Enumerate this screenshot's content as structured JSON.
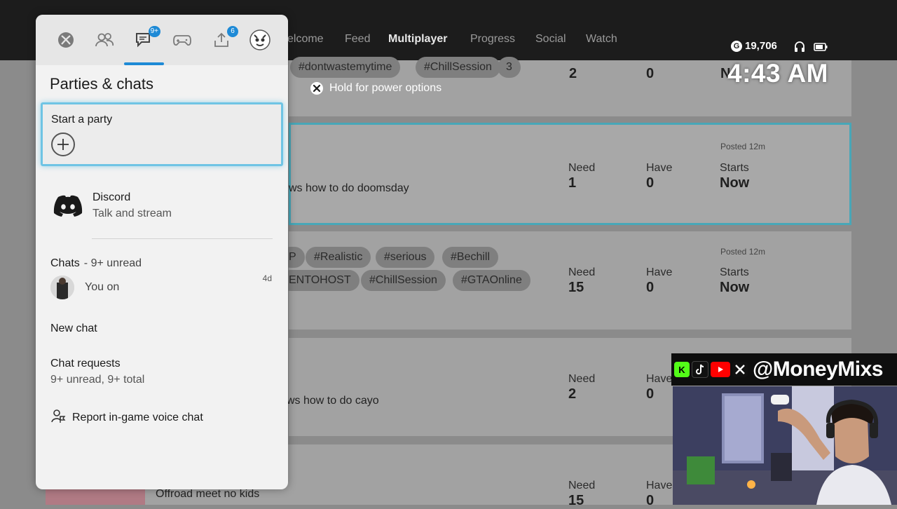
{
  "bg": {
    "nav": [
      "elcome",
      "Feed",
      "Multiplayer",
      "Progress",
      "Social",
      "Watch"
    ],
    "gamerscore": "19,706",
    "gamerscore_glyph": "G",
    "clock": "4:43 AM",
    "power_hint": "Hold for power options",
    "cards": [
      {
        "tags": [
          "#dontwastemytime",
          "#ChillSession",
          "3"
        ],
        "need": "2",
        "have": "0",
        "starts": "N"
      },
      {
        "posted": "Posted 12m",
        "desc": "ws how to do doomsday",
        "need_label": "Need",
        "have_label": "Have",
        "starts_label": "Starts",
        "need": "1",
        "have": "0",
        "starts": "Now"
      },
      {
        "posted": "Posted 12m",
        "tags_row1": [
          "P",
          "#Realistic",
          "#serious",
          "#Bechill"
        ],
        "tags_row2": [
          "ENTOHOST",
          "#ChillSession",
          "#GTAOnline"
        ],
        "need_label": "Need",
        "have_label": "Have",
        "starts_label": "Starts",
        "need": "15",
        "have": "0",
        "starts": "Now"
      },
      {
        "desc": "ws how to do cayo",
        "need_label": "Need",
        "have_label": "Have",
        "need": "2",
        "have": "0"
      },
      {
        "desc": "Offroad meet no kids",
        "need_label": "Need",
        "have_label": "Have",
        "need": "15",
        "have": "0"
      }
    ]
  },
  "guide": {
    "tabs": [
      {
        "icon": "xbox-icon",
        "badge": ""
      },
      {
        "icon": "people-icon",
        "badge": ""
      },
      {
        "icon": "chat-icon",
        "badge": "9+"
      },
      {
        "icon": "controller-icon",
        "badge": ""
      },
      {
        "icon": "upload-icon",
        "badge": "6"
      },
      {
        "icon": "profile-icon",
        "badge": ""
      }
    ],
    "title": "Parties & chats",
    "start_party": "Start a party",
    "discord_name": "Discord",
    "discord_sub": "Talk and stream",
    "chats_label": "Chats",
    "chats_unread": "- 9+ unread",
    "chat_preview": "You on",
    "chat_time": "4d",
    "new_chat": "New chat",
    "chat_requests": "Chat requests",
    "chat_requests_sub": "9+ unread, 9+ total",
    "report": "Report in-game voice chat"
  },
  "overlay": {
    "handle": "@MoneyMixs",
    "socials": [
      "K",
      "tiktok",
      "youtube",
      "X"
    ]
  },
  "colors": {
    "accent": "#1e8ad6",
    "focus": "#6fc4e4",
    "discord": "#5865f2"
  }
}
